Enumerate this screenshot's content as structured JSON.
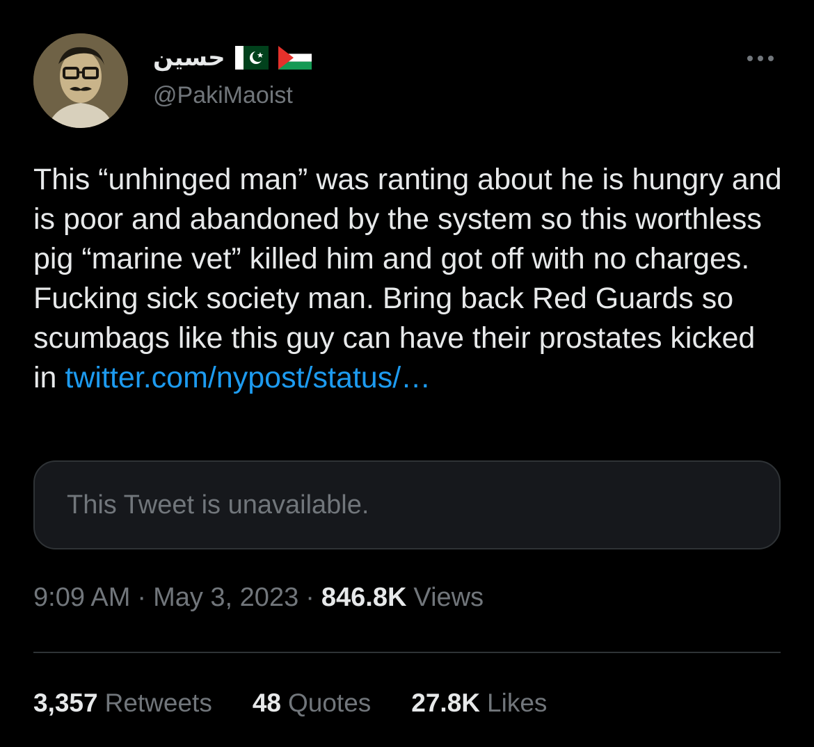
{
  "author": {
    "display_name": "حسين",
    "handle": "@PakiMaoist",
    "avatar": "profile-photo",
    "flags": [
      "pakistan-flag",
      "palestine-flag"
    ]
  },
  "menu": {
    "more_icon": "ellipsis-icon"
  },
  "tweet": {
    "text": "This “unhinged man” was ranting about he is hungry and is poor and abandoned by the system so this worthless pig “marine vet” killed him and got off with no charges. Fucking sick society man. Bring back Red Guards so scumbags like this guy can have their prostates kicked in ",
    "link_text": "twitter.com/nypost/status/…"
  },
  "quoted_tweet": {
    "text": "This Tweet is unavailable."
  },
  "meta": {
    "time": "9:09 AM",
    "separator": "·",
    "date": "May 3, 2023",
    "views_count": "846.8K",
    "views_label": "Views"
  },
  "stats": {
    "retweets_count": "3,357",
    "retweets_label": "Retweets",
    "quotes_count": "48",
    "quotes_label": "Quotes",
    "likes_count": "27.8K",
    "likes_label": "Likes"
  },
  "colors": {
    "background": "#000000",
    "text": "#e7e9ea",
    "secondary": "#71767b",
    "link": "#1d9bf0",
    "border": "#2f3336"
  }
}
